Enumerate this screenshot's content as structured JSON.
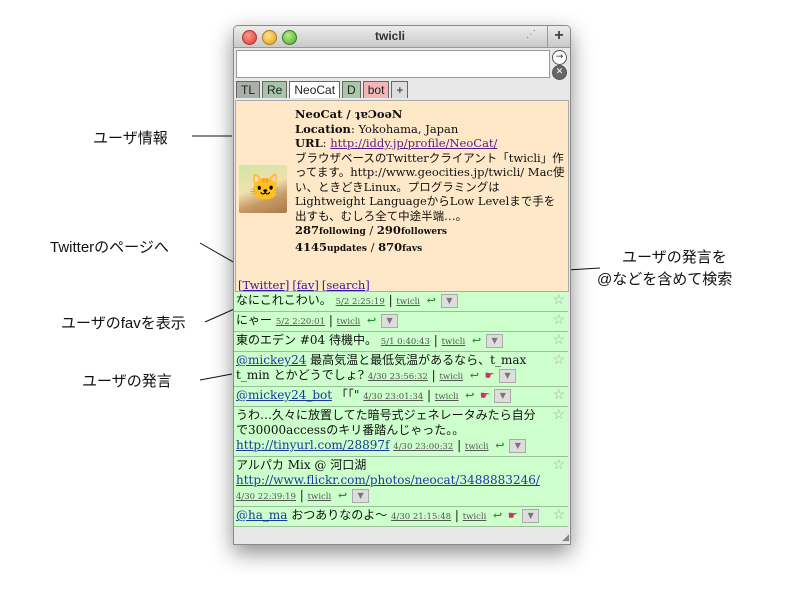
{
  "window": {
    "title": "twicli",
    "plus": "+",
    "resize_glyph": "⋰",
    "grip": "◢"
  },
  "input": {
    "value": "",
    "go": "→",
    "clear": "✕"
  },
  "tabs": [
    "TL",
    "Re",
    "NeoCat",
    "D",
    "bot",
    "+"
  ],
  "profile": {
    "name": "NeoCat / ʇɐƆoəN",
    "location_label": "Location",
    "location": "Yokohama, Japan",
    "url_label": "URL",
    "url": "http://iddy.jp/profile/NeoCat/",
    "bio": "ブラウザベースのTwitterクライアント「twicli」作ってます。http://www.geocities.jp/twicli/ Mac使い、ときどきLinux。プログラミングはLightweight LanguageからLow Levelまで手を出すも、むしろ全て中途半端…。",
    "following": "287",
    "following_label": "following",
    "followers": "290",
    "followers_label": "followers",
    "updates": "4145",
    "updates_label": "updates",
    "favs": "870",
    "favs_label": "favs",
    "links": [
      "[Twitter]",
      "[fav]",
      "[search]"
    ]
  },
  "tweets": [
    {
      "user": "",
      "text": "なにこれこわい。",
      "time": "5/2 2:25:19",
      "src": "twicli",
      "hand": false
    },
    {
      "user": "",
      "text": "にゃー",
      "time": "5/2 2:20:01",
      "src": "twicli",
      "hand": false
    },
    {
      "user": "",
      "text": "東のエデン #04 待機中。",
      "time": "5/1 0:40:43",
      "src": "twicli",
      "hand": false
    },
    {
      "user": "@mickey24",
      "text": " 最高気温と最低気温があるなら、t_max t_min とかどうでしょ?",
      "time": "4/30 23:56:32",
      "src": "twicli",
      "hand": true
    },
    {
      "user": "@mickey24_bot",
      "text": " 「「\"",
      "time": "4/30 23:01:34",
      "src": "twicli",
      "hand": true
    },
    {
      "user": "",
      "text": "うわ…久々に放置してた暗号式ジェネレータみたら自分で30000accessのキリ番踏んじゃった。。",
      "url": "http://tinyurl.com/28897f",
      "time": "4/30 23:00:32",
      "src": "twicli",
      "hand": false
    },
    {
      "user": "",
      "text": "アルパカ Mix @ 河口湖",
      "url": "http://www.flickr.com/photos/neocat/3488883246/",
      "time": "4/30 22:39:19",
      "src": "twicli",
      "hand": false
    },
    {
      "user": "@ha_ma",
      "text": " おつありなのよ〜",
      "time": "4/30 21:15:48",
      "src": "twicli",
      "hand": true
    }
  ],
  "icons": {
    "reply": "reply-arrow-icon",
    "hand": "pointing-hand-icon",
    "menu": "dropdown-triangle-icon",
    "star": "star-icon"
  },
  "annotations": {
    "user_info": "ユーザ情報",
    "twitter_page": "Twitterのページへ",
    "show_fav": "ユーザのfavを表示",
    "user_posts": "ユーザの発言",
    "search_line1": "ユーザの発言を",
    "search_line2": "@などを含めて検索"
  },
  "colors": {
    "profile_bg": "#fee8c8",
    "tweet_bg": "#ccffcc",
    "link": "#3b16a0"
  }
}
